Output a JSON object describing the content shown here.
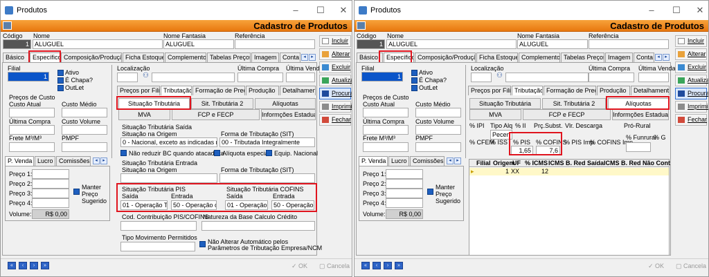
{
  "window": {
    "title": "Produtos",
    "header": "Cadastro de Produtos"
  },
  "fields": {
    "codigo_label": "Código",
    "nome_label": "Nome",
    "fantasia_label": "Nome Fantasia",
    "referencia_label": "Referência",
    "codigo": "1",
    "nome": "ALUGUEL",
    "fantasia": "ALUGUEL",
    "referencia": ""
  },
  "tabs": [
    "Básico",
    "Específico",
    "Composição/Produção",
    "Ficha Estoque",
    "Complemento",
    "Tabelas Preços",
    "Imagem",
    "Conta"
  ],
  "side_buttons": {
    "incluir": "Incluir",
    "alterar": "Alterar",
    "excluir": "Excluir",
    "atualizar": "Atualizar",
    "procurar": "Procurar",
    "imprimir": "Imprimir",
    "fechar": "Fechar"
  },
  "left": {
    "filial": "Filial",
    "filial_value": "1",
    "ativo": "Ativo",
    "chapa": "É Chapa?",
    "outlet": "OutLet",
    "precos_custo": "Preços de Custo",
    "custo_atual": "Custo Atual",
    "custo_medio": "Custo Médio",
    "ultima_compra": "Última Compra",
    "custo_volume": "Custo Volume",
    "frete": "Frete M³/M³",
    "pmpf": "PMPF",
    "tabs": [
      "P. Venda",
      "Lucro",
      "Comissões"
    ],
    "preco1": "Preço 1:",
    "preco2": "Preço 2:",
    "preco3": "Preço 3:",
    "preco4": "Preço 4:",
    "volume": "Volume:",
    "volume_value": "R$ 0,00",
    "manter": "Manter",
    "preco": "Preço",
    "sugerido": "Sugerido"
  },
  "right": {
    "localizacao": "Localização",
    "ultima_compra": "Última Compra",
    "ultima_venda": "Última Venda",
    "sub_tabs": [
      "Preços por Filial",
      "Tributação",
      "Formação de Preço",
      "Produção",
      "Detalhamento"
    ],
    "trib_tabs": [
      "Situação Tributária",
      "Sit. Tributária 2",
      "Alíquotas",
      "MVA",
      "FCP e FECP",
      "Informções Estaduais"
    ]
  },
  "w1": {
    "sit_saida": "Situação Tributária Saída",
    "sit_origem": "Situação na Origem",
    "forma_sit": "Forma de Tributação (SIT)",
    "origem_value": "0 - Nacional, exceto as indicadas nos có",
    "forma_value": "00 - Tributada Integralmente",
    "nao_reduzir": "Não reduzir BC quando atacadista",
    "aliq_especial": "Alíquota especial",
    "equip": "Equip. Nacional",
    "sit_entrada": "Situação Tributária Entrada",
    "sit_origem2": "Situação na Origem",
    "forma_sit2": "Forma de Tributação (SIT)",
    "pis_title": "Situação Tributária PIS",
    "cofins_title": "Situação Tributária COFINS",
    "saida": "Saída",
    "entrada": "Entrada",
    "pis_saida": "01 - Operação Trib",
    "pis_entrada": "50 - Operação c",
    "cofins_saida": "01 - Operação",
    "cofins_entrada": "50 - Operação",
    "cod_contrib": "Cod. Contribuição PIS/COFINS",
    "natureza": "Natureza da Base Calculo Crédito",
    "tipo_mov": "Tipo Movimento Permitidos",
    "nao_alterar": "Não Alterar Automático pelos",
    "parametros": "Parâmetros de Tributação Empresa/NCM"
  },
  "w2": {
    "ipi": "% IPI",
    "tipo_alq": "Tipo Alq",
    "ii": "% II",
    "prc_subst": "Prç.Subst.",
    "vlr_descarga": "Vlr. Descarga",
    "pro_rural": "Pró-Rural",
    "tipo_alq_value": "Pecen",
    "cfem": "% CFEM",
    "iss": "% ISS",
    "pis": "% PIS",
    "cofins": "% COFINS",
    "pis_imp": "% PIS Imp.",
    "cofins_imp": "% COFINS Imp.",
    "funrural": "% Funrural",
    "pct_g": "% G",
    "pis_value": "1,65",
    "cofins_value": "7,6",
    "grid_headers": [
      "Filial",
      "Origem",
      "UF",
      "% ICMS",
      "ICMS B. Red Saída",
      "ICMS B. Red Não Cont"
    ],
    "grid_row": {
      "filial": "",
      "origem": "1",
      "uf": "XX",
      "icms": "12"
    }
  },
  "footer": {
    "ok": "OK",
    "cancela": "Cancela"
  }
}
